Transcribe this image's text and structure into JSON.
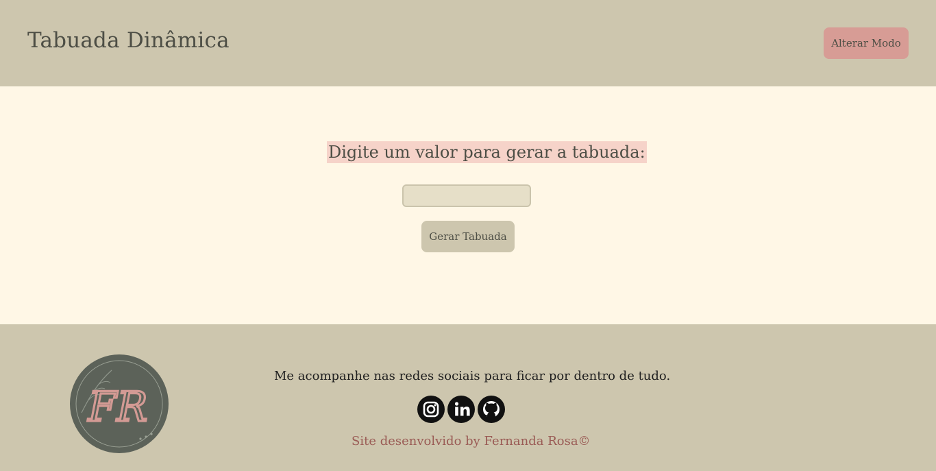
{
  "header": {
    "title": "Tabuada Dinâmica",
    "mode_button_label": "Alterar Modo"
  },
  "main": {
    "prompt": "Digite um valor para gerar a tabuada:",
    "input_value": "",
    "generate_button_label": "Gerar Tabuada"
  },
  "footer": {
    "logo_text": "FR",
    "follow_text": "Me acompanhe nas redes sociais para ficar por dentro de tudo.",
    "social_icons": [
      "instagram-icon",
      "linkedin-icon",
      "github-icon"
    ],
    "credit": "Site desenvolvido by Fernanda Rosa©"
  },
  "colors": {
    "header_bg": "#cdc6ae",
    "page_bg": "#fff7e6",
    "accent_pink": "#d79c95",
    "highlight_pink": "#f6d3c9",
    "credit_text": "#9a5b55"
  }
}
